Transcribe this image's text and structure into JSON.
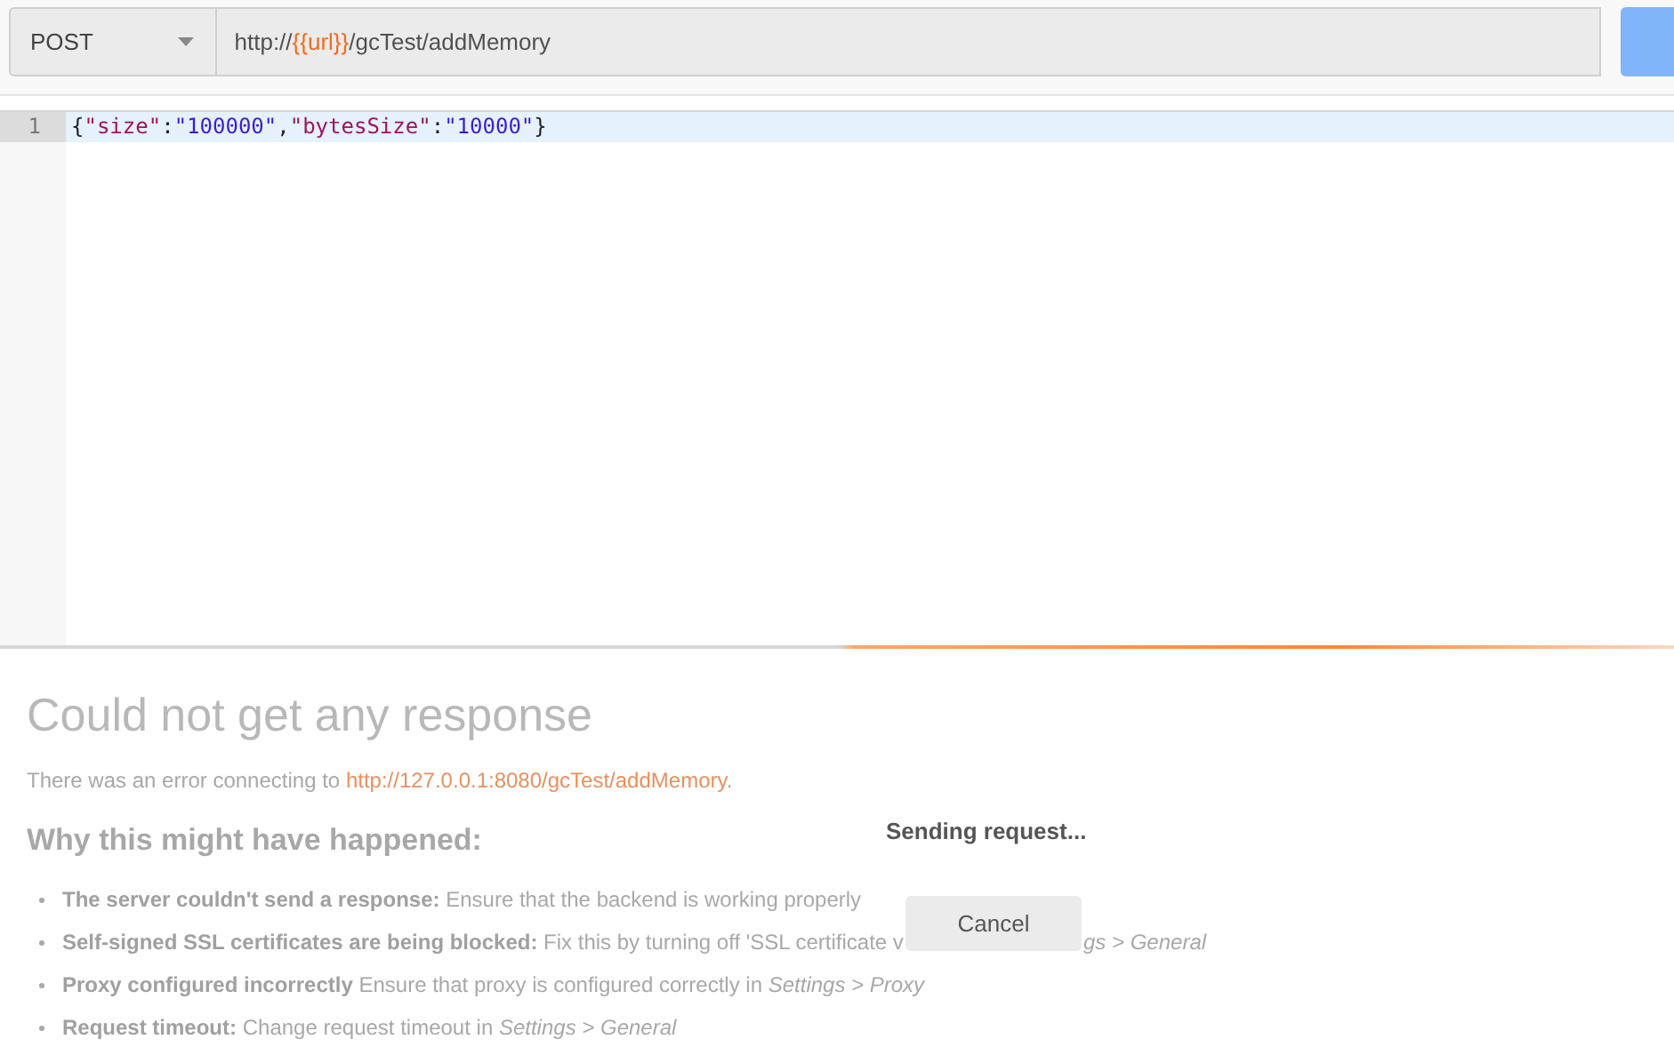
{
  "request": {
    "method": "POST",
    "url_parts": [
      {
        "text": "http://",
        "kind": "plain"
      },
      {
        "text": "{{url}}",
        "kind": "variable"
      },
      {
        "text": "/gcTest/addMemory",
        "kind": "plain"
      }
    ]
  },
  "editor": {
    "lines": [
      {
        "number": "1",
        "selected": true,
        "tokens": [
          {
            "text": "{",
            "kind": "punct"
          },
          {
            "text": "\"size\"",
            "kind": "key"
          },
          {
            "text": ":",
            "kind": "punct"
          },
          {
            "text": "\"100000\"",
            "kind": "string"
          },
          {
            "text": ",",
            "kind": "punct"
          },
          {
            "text": "\"bytesSize\"",
            "kind": "key"
          },
          {
            "text": ":",
            "kind": "punct"
          },
          {
            "text": "\"10000\"",
            "kind": "string"
          },
          {
            "text": "}",
            "kind": "punct"
          }
        ]
      }
    ]
  },
  "response": {
    "title": "Could not get any response",
    "message": "There was an error connecting to ",
    "link": "http://127.0.0.1:8080/gcTest/addMemory",
    "message_end": ".",
    "reasons_heading": "Why this might have happened:",
    "reasons": [
      {
        "label": "The server couldn't send a response:",
        "detail": "Ensure that the backend is working properly"
      },
      {
        "label": "Self-signed SSL certificates are being blocked:",
        "detail": "Fix this by turning off 'SSL certificate v",
        "detail_tail": "*gs > General*"
      },
      {
        "label": "Proxy configured incorrectly",
        "detail": "Ensure that proxy is configured correctly in *Settings > Proxy*"
      },
      {
        "label": "Request timeout:",
        "detail": "Change request timeout in *Settings > General*"
      }
    ]
  },
  "overlay": {
    "status": "Sending request...",
    "cancel": "Cancel"
  }
}
